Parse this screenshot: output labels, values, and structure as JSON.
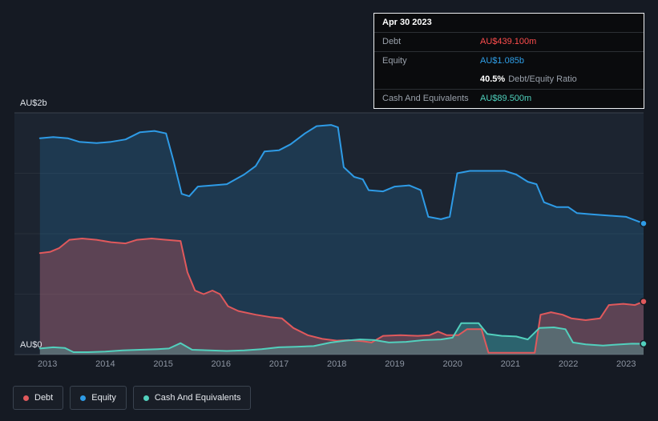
{
  "tooltip": {
    "date": "Apr 30 2023",
    "debt_label": "Debt",
    "debt_value": "AU$439.100m",
    "equity_label": "Equity",
    "equity_value": "AU$1.085b",
    "ratio_value": "40.5%",
    "ratio_label": "Debt/Equity Ratio",
    "cash_label": "Cash And Equivalents",
    "cash_value": "AU$89.500m"
  },
  "colors": {
    "background": "#151a23",
    "plot_background": "#1c2430",
    "debt_line": "#e0595c",
    "equity_line": "#2e9be6",
    "cash_line": "#52d0bd",
    "debt_text": "#ff4d4d",
    "equity_text": "#2f9fe8",
    "cash_text": "#4fd1bd",
    "axis_line": "#3a424e"
  },
  "legend": {
    "items": [
      {
        "label": "Debt",
        "color": "#e0595c"
      },
      {
        "label": "Equity",
        "color": "#2e9be6"
      },
      {
        "label": "Cash And Equivalents",
        "color": "#52d0bd"
      }
    ]
  },
  "chart_data": {
    "type": "area",
    "unit": "AU$ billions",
    "ylim": [
      0,
      2
    ],
    "x_range": [
      2012.43,
      2023.3
    ],
    "grid": "horizontal",
    "gridlines": [
      0,
      0.5,
      1,
      1.5,
      2
    ],
    "legend_position": "bottom-left",
    "y_axis_labels": {
      "top": "AU$2b",
      "bottom": "AU$0"
    },
    "x_ticks": [
      {
        "label": "2013",
        "year": 2013
      },
      {
        "label": "2014",
        "year": 2014
      },
      {
        "label": "2015",
        "year": 2015
      },
      {
        "label": "2016",
        "year": 2016
      },
      {
        "label": "2017",
        "year": 2017
      },
      {
        "label": "2018",
        "year": 2018
      },
      {
        "label": "2019",
        "year": 2019
      },
      {
        "label": "2020",
        "year": 2020
      },
      {
        "label": "2021",
        "year": 2021
      },
      {
        "label": "2022",
        "year": 2022
      },
      {
        "label": "2023",
        "year": 2023
      }
    ],
    "series": [
      {
        "name": "Equity",
        "color": "#2e9be6",
        "fill": "rgba(46,155,230,0.18)",
        "points": [
          [
            2012.87,
            1.79
          ],
          [
            2013.1,
            1.8
          ],
          [
            2013.35,
            1.79
          ],
          [
            2013.55,
            1.76
          ],
          [
            2013.85,
            1.75
          ],
          [
            2014.1,
            1.76
          ],
          [
            2014.35,
            1.78
          ],
          [
            2014.6,
            1.84
          ],
          [
            2014.85,
            1.85
          ],
          [
            2015.05,
            1.83
          ],
          [
            2015.18,
            1.6
          ],
          [
            2015.32,
            1.33
          ],
          [
            2015.45,
            1.31
          ],
          [
            2015.6,
            1.39
          ],
          [
            2015.85,
            1.4
          ],
          [
            2016.1,
            1.41
          ],
          [
            2016.4,
            1.49
          ],
          [
            2016.6,
            1.56
          ],
          [
            2016.75,
            1.68
          ],
          [
            2017.0,
            1.69
          ],
          [
            2017.2,
            1.74
          ],
          [
            2017.45,
            1.83
          ],
          [
            2017.65,
            1.89
          ],
          [
            2017.9,
            1.9
          ],
          [
            2018.02,
            1.88
          ],
          [
            2018.12,
            1.55
          ],
          [
            2018.3,
            1.47
          ],
          [
            2018.45,
            1.45
          ],
          [
            2018.55,
            1.36
          ],
          [
            2018.8,
            1.35
          ],
          [
            2019.0,
            1.39
          ],
          [
            2019.25,
            1.4
          ],
          [
            2019.45,
            1.36
          ],
          [
            2019.58,
            1.14
          ],
          [
            2019.8,
            1.12
          ],
          [
            2019.95,
            1.14
          ],
          [
            2020.08,
            1.5
          ],
          [
            2020.3,
            1.52
          ],
          [
            2020.6,
            1.52
          ],
          [
            2020.9,
            1.52
          ],
          [
            2021.1,
            1.49
          ],
          [
            2021.3,
            1.43
          ],
          [
            2021.45,
            1.41
          ],
          [
            2021.58,
            1.26
          ],
          [
            2021.8,
            1.22
          ],
          [
            2022.0,
            1.22
          ],
          [
            2022.15,
            1.17
          ],
          [
            2022.4,
            1.16
          ],
          [
            2022.7,
            1.15
          ],
          [
            2023.0,
            1.14
          ],
          [
            2023.3,
            1.085
          ]
        ]
      },
      {
        "name": "Debt",
        "color": "#e0595c",
        "fill": "rgba(224,89,92,0.32)",
        "points": [
          [
            2012.87,
            0.84
          ],
          [
            2013.05,
            0.85
          ],
          [
            2013.2,
            0.88
          ],
          [
            2013.38,
            0.95
          ],
          [
            2013.6,
            0.96
          ],
          [
            2013.85,
            0.95
          ],
          [
            2014.1,
            0.93
          ],
          [
            2014.35,
            0.92
          ],
          [
            2014.55,
            0.95
          ],
          [
            2014.8,
            0.96
          ],
          [
            2015.05,
            0.95
          ],
          [
            2015.3,
            0.94
          ],
          [
            2015.42,
            0.68
          ],
          [
            2015.55,
            0.53
          ],
          [
            2015.7,
            0.5
          ],
          [
            2015.85,
            0.53
          ],
          [
            2015.98,
            0.5
          ],
          [
            2016.12,
            0.4
          ],
          [
            2016.3,
            0.36
          ],
          [
            2016.6,
            0.33
          ],
          [
            2016.85,
            0.31
          ],
          [
            2017.05,
            0.3
          ],
          [
            2017.25,
            0.22
          ],
          [
            2017.5,
            0.16
          ],
          [
            2017.75,
            0.13
          ],
          [
            2018.0,
            0.115
          ],
          [
            2018.2,
            0.12
          ],
          [
            2018.45,
            0.11
          ],
          [
            2018.6,
            0.1
          ],
          [
            2018.8,
            0.155
          ],
          [
            2019.1,
            0.16
          ],
          [
            2019.4,
            0.155
          ],
          [
            2019.6,
            0.16
          ],
          [
            2019.75,
            0.19
          ],
          [
            2019.9,
            0.16
          ],
          [
            2020.1,
            0.16
          ],
          [
            2020.25,
            0.21
          ],
          [
            2020.5,
            0.21
          ],
          [
            2020.62,
            0.015
          ],
          [
            2020.9,
            0.015
          ],
          [
            2021.2,
            0.015
          ],
          [
            2021.42,
            0.015
          ],
          [
            2021.52,
            0.33
          ],
          [
            2021.7,
            0.35
          ],
          [
            2021.9,
            0.33
          ],
          [
            2022.05,
            0.3
          ],
          [
            2022.3,
            0.285
          ],
          [
            2022.55,
            0.3
          ],
          [
            2022.7,
            0.41
          ],
          [
            2022.95,
            0.42
          ],
          [
            2023.15,
            0.41
          ],
          [
            2023.3,
            0.439
          ]
        ]
      },
      {
        "name": "Cash And Equivalents",
        "color": "#52d0bd",
        "fill": "rgba(82,208,189,0.28)",
        "points": [
          [
            2012.87,
            0.05
          ],
          [
            2013.1,
            0.06
          ],
          [
            2013.3,
            0.055
          ],
          [
            2013.45,
            0.02
          ],
          [
            2013.7,
            0.02
          ],
          [
            2014.0,
            0.025
          ],
          [
            2014.3,
            0.035
          ],
          [
            2014.6,
            0.04
          ],
          [
            2014.9,
            0.045
          ],
          [
            2015.1,
            0.05
          ],
          [
            2015.3,
            0.095
          ],
          [
            2015.5,
            0.04
          ],
          [
            2015.8,
            0.035
          ],
          [
            2016.1,
            0.03
          ],
          [
            2016.4,
            0.035
          ],
          [
            2016.7,
            0.045
          ],
          [
            2017.0,
            0.06
          ],
          [
            2017.3,
            0.065
          ],
          [
            2017.6,
            0.07
          ],
          [
            2017.9,
            0.1
          ],
          [
            2018.15,
            0.115
          ],
          [
            2018.4,
            0.125
          ],
          [
            2018.65,
            0.12
          ],
          [
            2018.9,
            0.1
          ],
          [
            2019.2,
            0.105
          ],
          [
            2019.5,
            0.12
          ],
          [
            2019.8,
            0.125
          ],
          [
            2020.0,
            0.14
          ],
          [
            2020.15,
            0.26
          ],
          [
            2020.45,
            0.26
          ],
          [
            2020.6,
            0.17
          ],
          [
            2020.85,
            0.155
          ],
          [
            2021.1,
            0.15
          ],
          [
            2021.3,
            0.125
          ],
          [
            2021.5,
            0.22
          ],
          [
            2021.75,
            0.225
          ],
          [
            2021.95,
            0.21
          ],
          [
            2022.08,
            0.1
          ],
          [
            2022.3,
            0.085
          ],
          [
            2022.6,
            0.075
          ],
          [
            2022.9,
            0.085
          ],
          [
            2023.1,
            0.09
          ],
          [
            2023.3,
            0.0895
          ]
        ]
      }
    ]
  }
}
